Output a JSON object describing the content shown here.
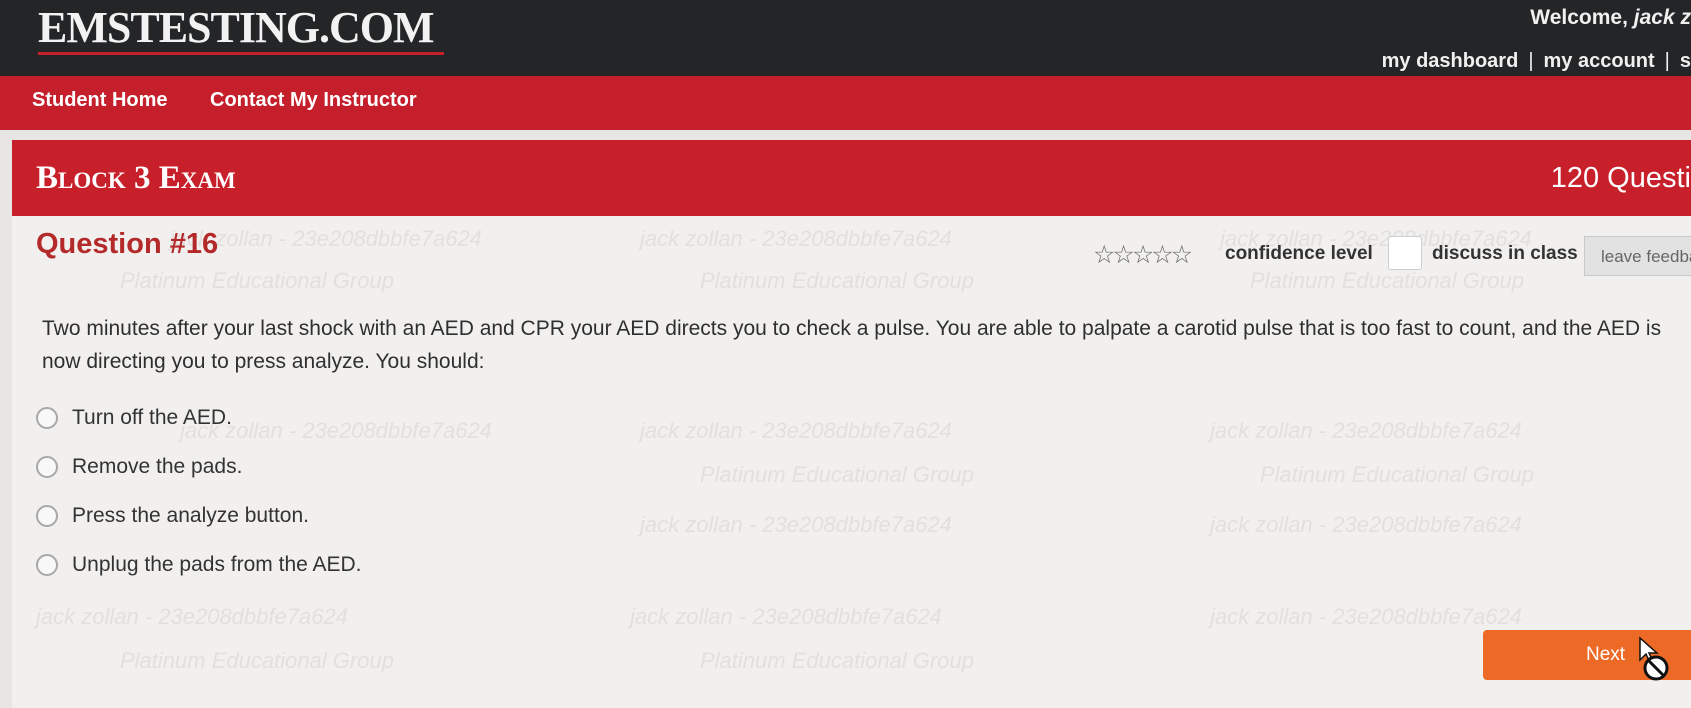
{
  "header": {
    "logo": "EMSTESTING.COM",
    "welcome_prefix": "Welcome,",
    "welcome_user": "jack z",
    "links": [
      "my dashboard",
      "my account",
      "s"
    ],
    "separator": "|"
  },
  "nav": {
    "items": [
      "Student Home",
      "Contact My Instructor"
    ]
  },
  "exam": {
    "title": "Block 3 Exam",
    "question_count": "120 Questi"
  },
  "question": {
    "number_label": "Question #16",
    "stars": "☆☆☆☆☆",
    "confidence_label": "confidence level",
    "discuss_label": "discuss in class",
    "feedback_label": "leave feedba",
    "text": "Two minutes after your last shock with an AED and CPR your AED directs you to check a pulse. You are able to palpate a carotid pulse that is too fast to count, and the AED is now directing you to press analyze. You should:",
    "answers": [
      "Turn off the AED.",
      "Remove the pads.",
      "Press the analyze button.",
      "Unplug the pads from the AED."
    ]
  },
  "watermark": {
    "id_text": "jack zollan - 23e208dbbfe7a624",
    "group_text": "Platinum Educational Group"
  },
  "footer": {
    "next_label": "Next"
  },
  "colors": {
    "topbar": "#242527",
    "red": "#c8202a",
    "question_red": "#b42a2a",
    "next_orange": "#ec6a26"
  },
  "icons": {
    "cursor": "arrow-cursor-with-not-allowed-icon"
  }
}
